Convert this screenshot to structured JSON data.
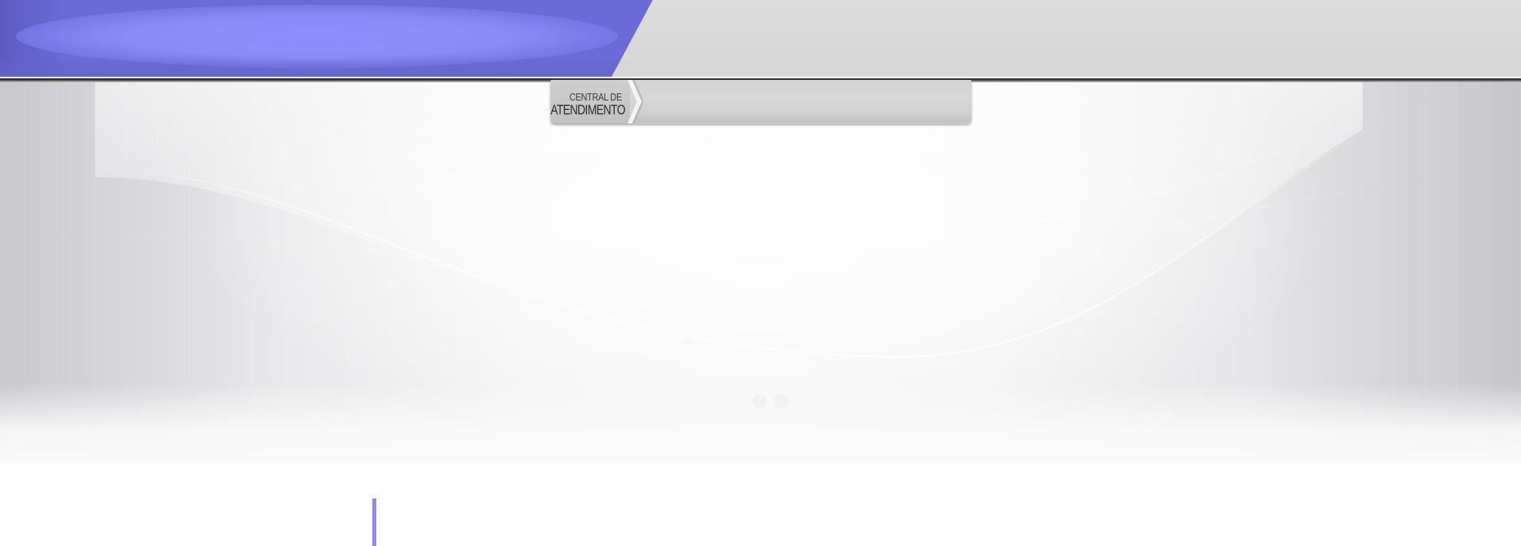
{
  "header": {
    "brand_color": "#8a8af8",
    "bar_color": "#d8d8d8"
  },
  "support_tab": {
    "label_line1": "CENTRAL DE",
    "label_line2": "ATENDIMENTO",
    "chevron_icon": "chevron-right-icon"
  },
  "slider": {
    "dot_count": 2,
    "dots": [
      {
        "name": "slide-1"
      },
      {
        "name": "slide-2"
      }
    ]
  },
  "content": {
    "accent_color": "#8a8af4"
  }
}
